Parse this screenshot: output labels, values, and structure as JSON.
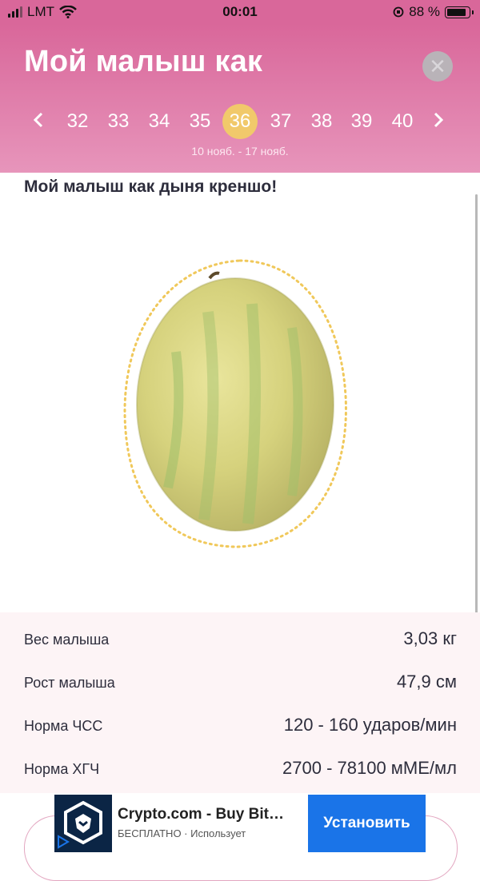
{
  "status_bar": {
    "carrier": "LMT",
    "time": "00:01",
    "battery": "88 %"
  },
  "header": {
    "title": "Мой малыш как",
    "weeks": [
      "32",
      "33",
      "34",
      "35",
      "36",
      "37",
      "38",
      "39",
      "40"
    ],
    "active_week": "36",
    "date_range": "10 нояб. - 17 нояб.",
    "accent_color": "#d9679a",
    "active_color": "#f1c96b"
  },
  "content": {
    "subtitle": "Мой малыш как дыня креншо!",
    "image": "melon-image"
  },
  "stats": [
    {
      "label": "Вес малыша",
      "value": "3,03 кг"
    },
    {
      "label": "Рост малыша",
      "value": "47,9 см"
    },
    {
      "label": "Норма ЧСС",
      "value": "120 - 160 ударов/мин"
    },
    {
      "label": "Норма ХГЧ",
      "value": "2700 - 78100 мМЕ/мл"
    }
  ],
  "ad": {
    "title": "Crypto.com - Buy Bit…",
    "subtitle": "БЕСПЛАТНО · Использует",
    "button": "Установить"
  }
}
